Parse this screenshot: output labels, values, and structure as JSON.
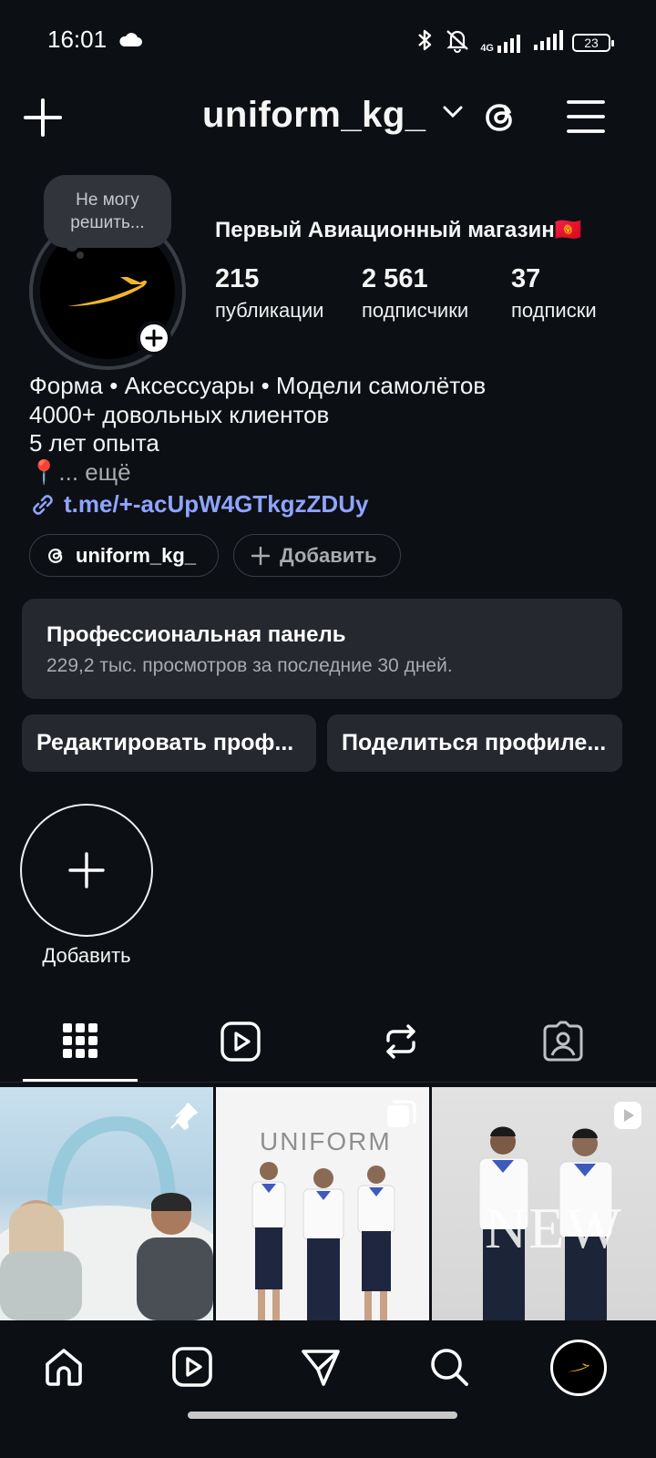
{
  "status_bar": {
    "time": "16:01",
    "battery": "23",
    "network_label": "4G"
  },
  "header": {
    "username": "uniform_kg_"
  },
  "note": {
    "line1": "Не могу",
    "line2": "решить..."
  },
  "profile": {
    "name": "Первый Авиационный магазин🇰🇬",
    "stats": [
      {
        "value": "215",
        "label": "публикации"
      },
      {
        "value": "2 561",
        "label": "подписчики"
      },
      {
        "value": "37",
        "label": "подписки"
      }
    ],
    "bio": [
      "Форма • Аксессуары • Модели самолётов",
      "4000+ довольных клиентов",
      "5 лет опыта"
    ],
    "bio_more_pin": "📍",
    "bio_more": "... ещё",
    "link": "t.me/+-acUpW4GTkgzZDUy"
  },
  "chips": {
    "threads_label": "uniform_kg_",
    "add_label": "Добавить"
  },
  "pro_panel": {
    "title": "Профессиональная панель",
    "subtitle": "229,2 тыс. просмотров за последние 30 дней."
  },
  "buttons": {
    "edit": "Редактировать проф...",
    "share": "Поделиться профиле..."
  },
  "highlight": {
    "label": "Добавить"
  },
  "grid": {
    "tile2_text": "UNIFORM",
    "tile3_text": "NEW"
  },
  "colors": {
    "background": "#0c0f14",
    "panel": "#25282e",
    "link": "#8fa4ff",
    "brand_plane": "#f2b52a"
  }
}
